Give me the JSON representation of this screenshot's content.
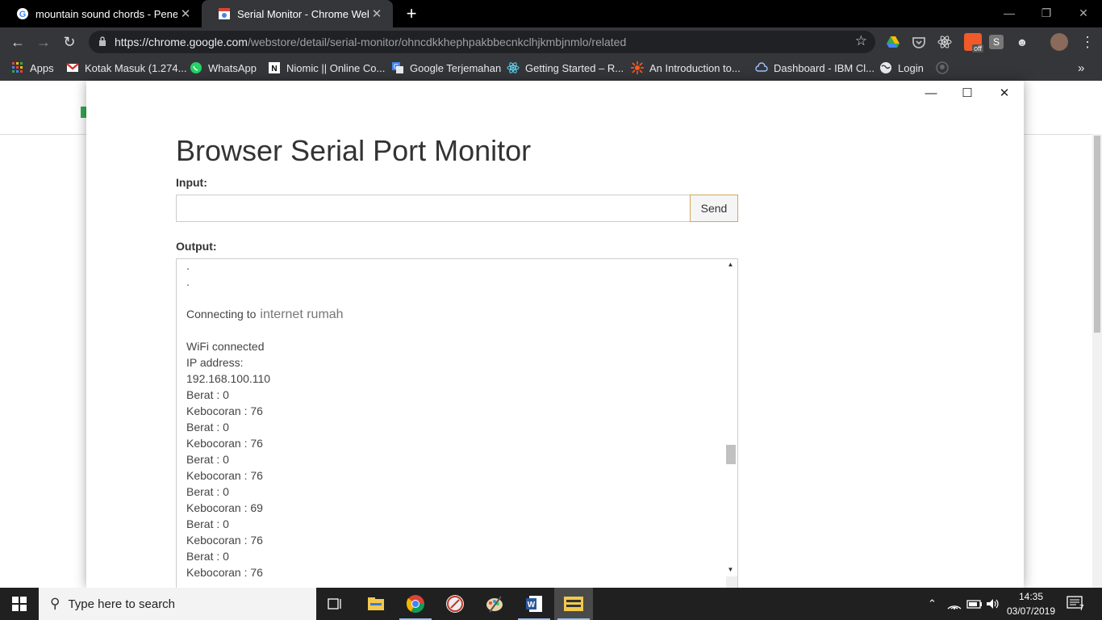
{
  "browser": {
    "tabs": [
      {
        "title": "mountain sound chords - Penelus",
        "close": "✕"
      },
      {
        "title": "Serial Monitor - Chrome Webstore",
        "close": "✕"
      }
    ],
    "new_tab": "+",
    "url_host": "https://chrome.google.com",
    "url_path": "/webstore/detail/serial-monitor/ohncdkkhephpakbbecnkclhjkmbjnmlo/related",
    "bookmarks": [
      {
        "label": "Apps",
        "icon": "apps-grid-icon",
        "color": "#e94235"
      },
      {
        "label": "Kotak Masuk (1.274...",
        "icon": "gmail-icon",
        "color": "#d93025"
      },
      {
        "label": "WhatsApp",
        "icon": "whatsapp-icon",
        "color": "#25d366"
      },
      {
        "label": "Niomic || Online Co...",
        "icon": "niomic-icon",
        "color": "#ffffff"
      },
      {
        "label": "Google Terjemahan",
        "icon": "translate-icon",
        "color": "#4285f4"
      },
      {
        "label": "Getting Started – R...",
        "icon": "react-icon",
        "color": "#61dafb"
      },
      {
        "label": "An Introduction to...",
        "icon": "sun-logo-icon",
        "color": "#ff5a1f"
      },
      {
        "label": "Dashboard - IBM Cl...",
        "icon": "ibm-cloud-icon",
        "color": "#a0c4ff"
      },
      {
        "label": "Login",
        "icon": "globe-icon",
        "color": "#e8eaed"
      }
    ],
    "ext_badge": "off"
  },
  "app": {
    "title": "Browser Serial Port Monitor",
    "input_label": "Input:",
    "input_value": "",
    "send_label": "Send",
    "output_label": "Output:",
    "output_lines": [
      {
        "text": ".",
        "big": false
      },
      {
        "text": ".",
        "big": false
      },
      {
        "text": ".",
        "big": false
      },
      {
        "text": "",
        "big": false
      },
      {
        "text": "Connecting to",
        "extra": "internet rumah",
        "big": false
      },
      {
        "text": "",
        "big": false
      },
      {
        "text": "WiFi connected",
        "big": false
      },
      {
        "text": "IP address:",
        "big": false
      },
      {
        "text": "192.168.100.110",
        "big": false
      },
      {
        "text": "Berat : 0",
        "big": false
      },
      {
        "text": "Kebocoran : 76",
        "big": false
      },
      {
        "text": "Berat : 0",
        "big": false
      },
      {
        "text": "Kebocoran : 76",
        "big": false
      },
      {
        "text": "Berat : 0",
        "big": false
      },
      {
        "text": "Kebocoran : 76",
        "big": false
      },
      {
        "text": "Berat : 0",
        "big": false
      },
      {
        "text": "Kebocoran : 69",
        "big": false
      },
      {
        "text": "Berat : 0",
        "big": false
      },
      {
        "text": "Kebocoran : 76",
        "big": false
      },
      {
        "text": "Berat : 0",
        "big": false
      },
      {
        "text": "Kebocoran : 76",
        "big": false
      }
    ]
  },
  "taskbar": {
    "search_placeholder": "Type here to search",
    "time": "14:35",
    "date": "03/07/2019",
    "notification_count": "7"
  }
}
